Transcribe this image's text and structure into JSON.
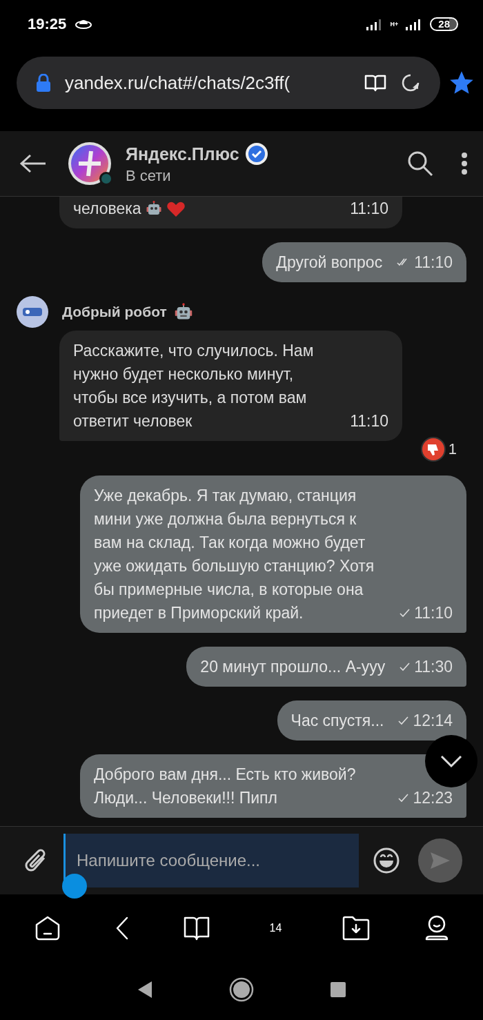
{
  "status_bar": {
    "time": "19:25",
    "network": "H+",
    "battery": "28"
  },
  "address_bar": {
    "url": "yandex.ru/chat#/chats/2c3ff(",
    "bookmarked": true
  },
  "chat_header": {
    "title": "Яндекс.Плюс",
    "verified": true,
    "online": true,
    "subtitle": "В сети"
  },
  "messages": [
    {
      "kind": "incoming",
      "clipped": true,
      "text": "человека",
      "emoji": true,
      "time": "11:10"
    },
    {
      "kind": "outgoing",
      "text": "Другой вопрос",
      "read": true,
      "time": "11:10"
    },
    {
      "kind": "incoming",
      "sender": "Добрый робот",
      "text": "Расскажите, что случилось. Нам нужно будет несколько минут, чтобы все изучить, а потом вам ответит человек",
      "time": "11:10",
      "reaction": {
        "count": "1"
      }
    },
    {
      "kind": "outgoing",
      "text": "Уже декабрь. Я так думаю, станция мини уже должна была вернуться к вам на склад. Так когда можно будет уже ожидать большую станцию? Хотя бы примерные числа, в которые она приедет в Приморский край.",
      "read": false,
      "time": "11:10"
    },
    {
      "kind": "outgoing",
      "text": "20 минут прошло... А-ууу",
      "read": false,
      "time": "11:30"
    },
    {
      "kind": "outgoing",
      "text": "Час спустя...",
      "read": false,
      "time": "12:14"
    },
    {
      "kind": "outgoing",
      "text": "Доброго вам дня... Есть кто живой? Люди... Человеки!!! Пипл",
      "read": false,
      "time": "12:23"
    }
  ],
  "composer": {
    "placeholder": "Напишите сообщение..."
  },
  "browser_toolbar": {
    "tabs_count": "14"
  }
}
